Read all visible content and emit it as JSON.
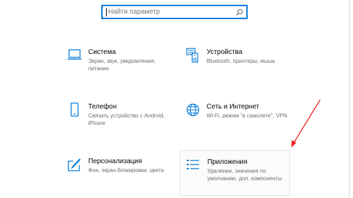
{
  "search": {
    "placeholder": "Найти параметр"
  },
  "tiles": [
    {
      "title": "Система",
      "desc": "Экран, звук, уведомления, питание",
      "icon": "laptop-icon"
    },
    {
      "title": "Устройства",
      "desc": "Bluetooth, принтеры, мышь",
      "icon": "keyboard-speaker-icon"
    },
    {
      "title": "Телефон",
      "desc": "Связать устройство с Android, iPhone",
      "icon": "phone-icon"
    },
    {
      "title": "Сеть и Интернет",
      "desc": "Wi-Fi, режим \"в самолете\", VPN",
      "icon": "globe-icon"
    },
    {
      "title": "Персонализация",
      "desc": "Фон, экран блокировки, цвета",
      "icon": "paint-brush-icon"
    },
    {
      "title": "Приложения",
      "desc": "Удаление, значения по умолчанию, доп. компоненты",
      "icon": "apps-list-icon"
    }
  ],
  "colors": {
    "accent": "#0078d7",
    "arrow": "#e8201b"
  }
}
